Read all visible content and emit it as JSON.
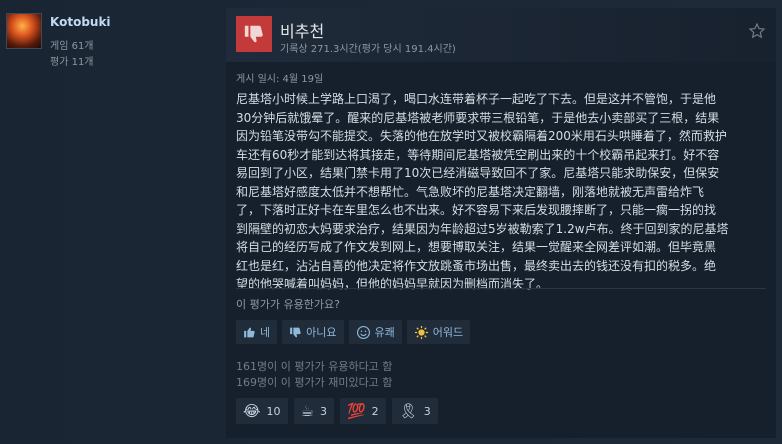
{
  "author": {
    "name": "Kotobuki",
    "games": "게임 61개",
    "reviews": "평가 11개"
  },
  "review": {
    "verdict": "비추천",
    "hours": "기록상 271.3시간(평가 당시 191.4시간)",
    "posted": "게시 일시: 4월 19일",
    "lines": [
      "尼基塔小时候上学路上口渴了，喝口水连带着杯子一起吃了下去。但是这并不管饱，于是他",
      "30分钟后就饿晕了。醒来的尼基塔被老师要求带三根铅笔，于是他去小卖部买了三根，结果",
      "因为铅笔没带勾不能提交。失落的他在放学时又被校霸隔着200米用石头哄睡着了，然而救护",
      "车还有60秒才能到达将其接走，等待期间尼基塔被凭空刷出来的十个校霸吊起来打。好不容",
      "易回到了小区，结果门禁卡用了10次已经消磁导致回不了家。尼基塔只能求助保安，但保安",
      "和尼基塔好感度太低并不想帮忙。气急败坏的尼基塔决定翻墙，刚落地就被无声雷给炸飞",
      "了，下落时正好卡在车里怎么也不出来。好不容易下来后发现腰摔断了，只能一瘸一拐的找",
      "到隔壁的初恋大妈要求治疗，结果因为年龄超过5岁被勒索了1.2w卢布。终于回到家的尼基塔",
      "将自己的经历写成了作文发到网上，想要博取关注，结果一觉醒来全网差评如潮。但毕竟黑",
      "红也是红，沾沾自喜的他决定将作文放跳蚤市场出售，最终卖出去的钱还没有扣的税多。绝",
      "望的他哭喊着叫妈妈，但他的妈妈早就因为删档而消失了。"
    ]
  },
  "feedback": {
    "question": "이 평가가 유용한가요?",
    "buttons": {
      "yes": "네",
      "no": "아니요",
      "funny": "유쾌",
      "award": "어워드"
    },
    "helpful_count": "161명이 이 평가가 유용하다고 함",
    "funny_count": "169명이 이 평가가 재미있다고 함"
  },
  "awards": [
    {
      "emoji": "😂",
      "icon": "laughing-face-icon",
      "count": "10"
    },
    {
      "emoji": "☕",
      "icon": "cake-cup-icon",
      "count": "3"
    },
    {
      "emoji": "💯",
      "icon": "hundred-points-icon",
      "count": "2"
    },
    {
      "emoji": "🎗",
      "icon": "ribbon-medal-icon",
      "count": "3"
    }
  ],
  "colors": {
    "background": "#1b2838",
    "thumb_down": "#c23a3a",
    "link": "#8fb9d9"
  }
}
